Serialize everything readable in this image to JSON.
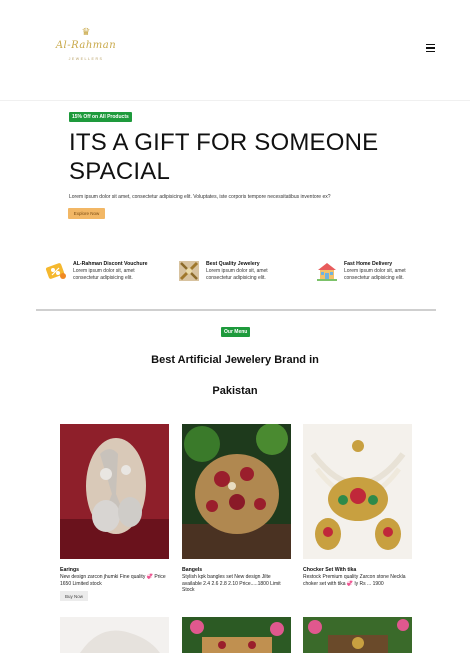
{
  "header": {
    "logo_script": "Al-Rahman",
    "logo_tag": "JEWELLERS",
    "menu_icon": "hamburger-menu-icon"
  },
  "hero": {
    "badge": "15% Off on All Products",
    "title": "ITS A GIFT FOR SOMEONE SPACIAL",
    "text": "Lorem ipsum dolor sit amet, consectetur adipisicing elit. Voluptates, iste corporis tempore necessitatibus inventore ex?",
    "button": "Explore Now"
  },
  "features": [
    {
      "icon": "voucher-icon",
      "title": "AL-Rahman Discont Vouchure",
      "desc": "Lorem ipsum dolor sit, amet consectetur adipisicing elit."
    },
    {
      "icon": "jewelry-quality-icon",
      "title": "Best Quality Jewelery",
      "desc": "Lorem ipsum dolor sit, amet consectetur adipisicing elit."
    },
    {
      "icon": "home-delivery-icon",
      "title": "Fast Home Delivery",
      "desc": "Lorem ipsum dolor sit, amet consectetur adipisicing elit."
    }
  ],
  "menu_section": {
    "badge": "Our Menu",
    "title_line1": "Best Artificial Jewelery Brand in",
    "title_line2": "Pakistan"
  },
  "products": [
    {
      "name": "Earings",
      "desc": "New design zarcon jhumki Fine quality 💞 Price 1650 Limited stock",
      "button": "Buy Now"
    },
    {
      "name": "Bangels",
      "desc": "Stylish kpk bangles set New design Jilte available 2.4 2.6 2.8 2.10 Price.....1800 Limit Stock",
      "button": ""
    },
    {
      "name": "Chocker Set With tika",
      "desc": "Restock Premium quality Zarcon stone Neckla choker set with tika 💞 ly Rs ... 1900",
      "button": ""
    }
  ],
  "colors": {
    "accent_green": "#1e9a3c",
    "button_orange": "#f2b765",
    "logo_gold": "#c9a94a"
  }
}
